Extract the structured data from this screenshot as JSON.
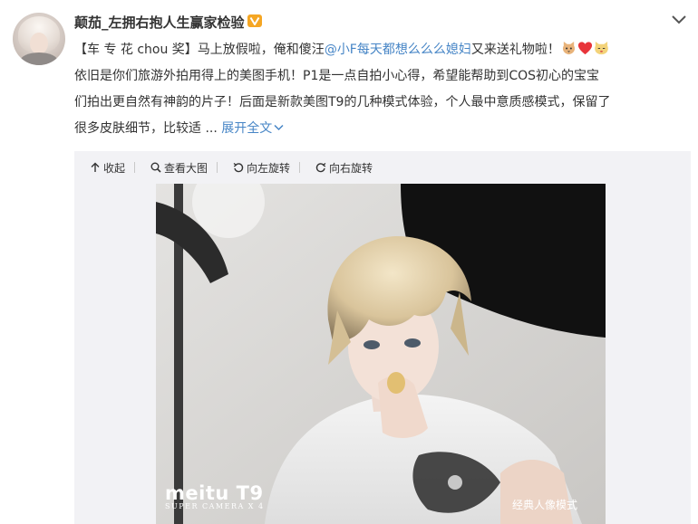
{
  "post": {
    "username": "颠茄_左拥右抱人生赢家检验",
    "text_lines": [
      {
        "tag": "【车 专 花 chou 奖】",
        "before_mention": "马上放假啦，俺和傻汪",
        "mention": "@小F每天都想么么么媳妇",
        "after_mention": "又来送礼物啦！"
      },
      "依旧是你们旅游外拍用得上的美图手机！P1是一点自拍小心得，希望能帮助到COS初心的宝宝",
      "们拍出更自然有神韵的片子！后面是新款美图T9的几种模式体验，个人最中意质感模式，保留了",
      {
        "text": "很多皮肤细节，比较适",
        "ellipsis": " ... ",
        "expand": "展开全文"
      }
    ],
    "emojis": [
      "cat-emoji",
      "heart-emoji",
      "cat-face-emoji"
    ]
  },
  "toolbar": {
    "collapse": "收起",
    "view_large": "查看大图",
    "rotate_left": "向左旋转",
    "rotate_right": "向右旋转"
  },
  "photo": {
    "brand_name": "meitu T9",
    "brand_sub": "SUPER CAMERA X 4",
    "mode_label": "经典人像模式"
  },
  "colors": {
    "accent_orange": "#eb7350",
    "link_blue": "#4685c6",
    "vip_badge": "#f5a623"
  }
}
